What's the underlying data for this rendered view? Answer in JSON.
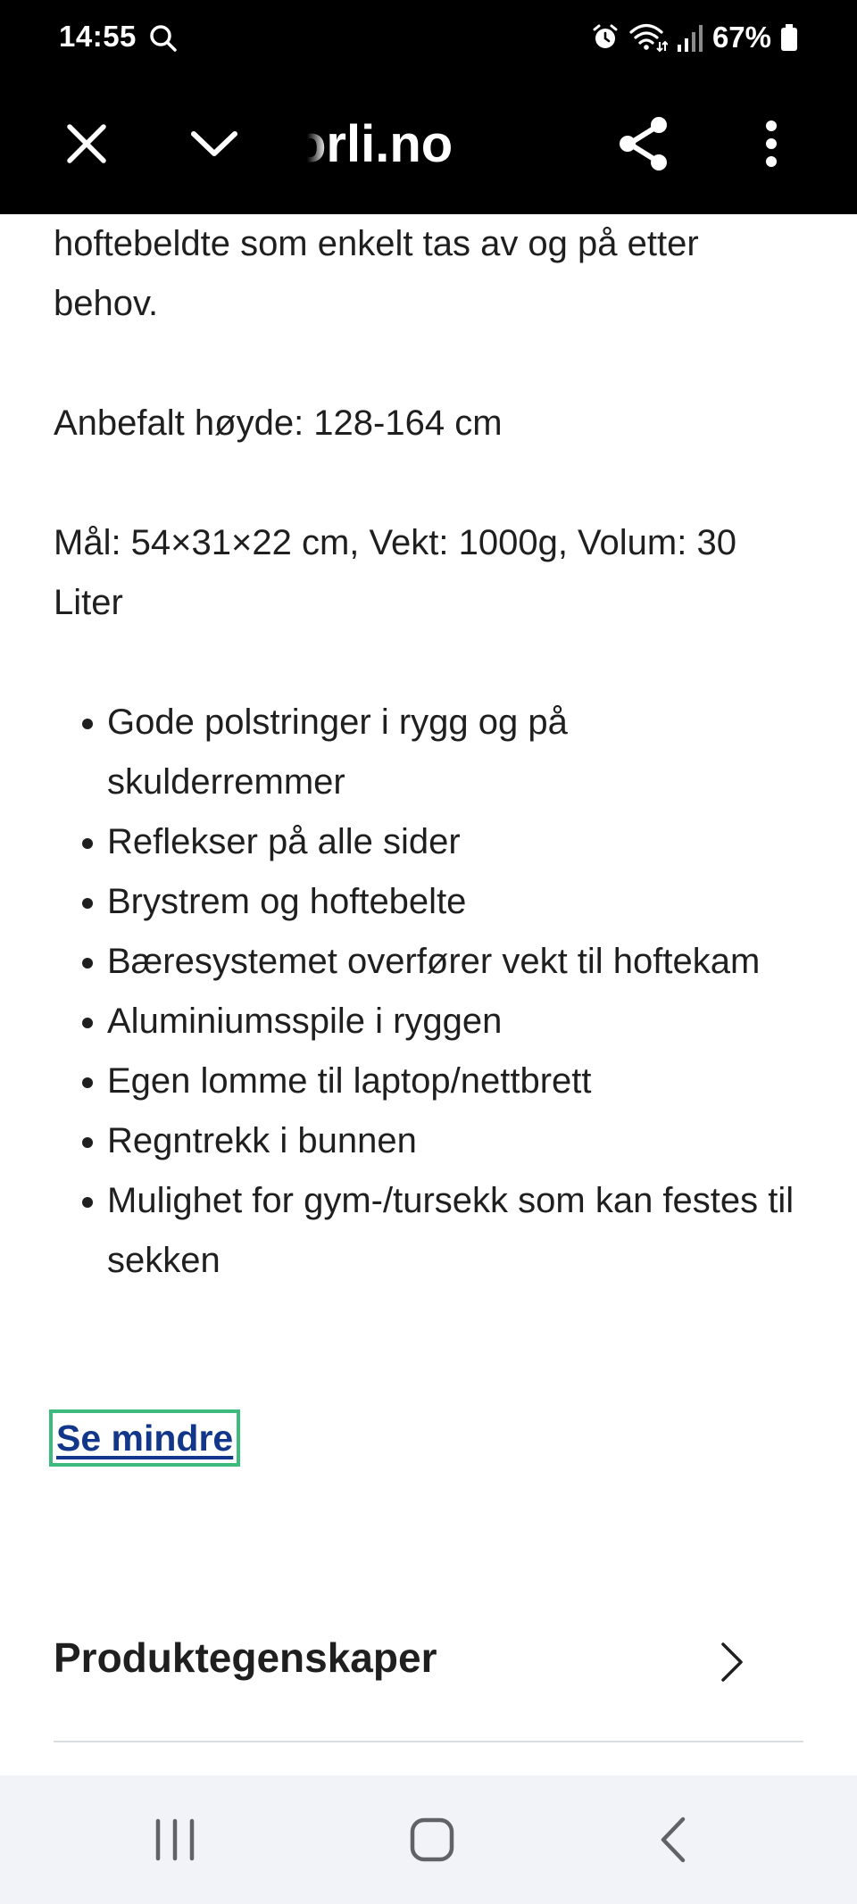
{
  "status_bar": {
    "time": "14:55",
    "battery": "67%",
    "icons": [
      "search-icon",
      "alarm-icon",
      "wifi-icon",
      "signal-icon",
      "battery-icon"
    ]
  },
  "toolbar": {
    "url": "orli.no",
    "icons": [
      "close-icon",
      "chevron-down-icon",
      "share-icon",
      "more-vertical-icon"
    ]
  },
  "content": {
    "intro_tail": "hoftebeldte som enkelt tas av og på etter behov.",
    "recommended_height": "Anbefalt høyde: 128-164 cm",
    "dimensions": "Mål: 54×31×22 cm, Vekt: 1000g, Volum: 30 Liter",
    "features": [
      "Gode polstringer i rygg og på skulderremmer",
      "Reflekser på alle sider",
      "Brystrem og hoftebelte",
      "Bæresystemet overfører vekt til hoftekam",
      "Aluminiumsspile i ryggen",
      "Egen lomme til laptop/nettbrett",
      "Regntrekk i bunnen",
      "Mulighet for gym-/tursekk som kan festes til sekken"
    ],
    "show_less_label": "Se mindre"
  },
  "accordion": {
    "title": "Produktegenskaper"
  },
  "colors": {
    "link": "#12378a",
    "focus_ring": "#3dba7e",
    "text": "#1f1f1f",
    "divider": "#d9dde3",
    "navbar_bg": "#f2f3f9"
  },
  "navbar": {
    "icons": [
      "recents-icon",
      "home-icon",
      "back-icon"
    ]
  }
}
